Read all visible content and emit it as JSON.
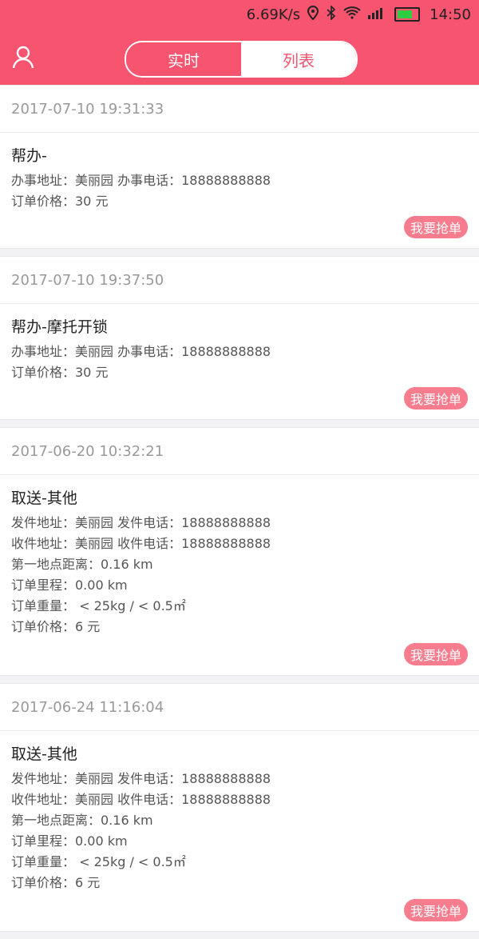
{
  "statusbar": {
    "speed": "6.69K/s",
    "time": "14:50"
  },
  "tabs": [
    {
      "label": "实时"
    },
    {
      "label": "列表"
    }
  ],
  "orders": [
    {
      "time": "2017-07-10 19:31:33",
      "title": "帮办-",
      "rows": [
        "办事地址：美丽园  办事电话：18888888888",
        "订单价格：30 元"
      ],
      "action": "我要抢单"
    },
    {
      "time": "2017-07-10 19:37:50",
      "title": "帮办-摩托开锁",
      "rows": [
        "办事地址：美丽园  办事电话：18888888888",
        "订单价格：30 元"
      ],
      "action": "我要抢单"
    },
    {
      "time": "2017-06-20 10:32:21",
      "title": "取送-其他",
      "rows": [
        "发件地址：美丽园  发件电话：18888888888",
        "收件地址：美丽园  收件电话：18888888888",
        "第一地点距离：0.16 km",
        "订单里程：0.00 km",
        "订单重量： < 25kg / < 0.5㎡",
        "订单价格：6 元"
      ],
      "action": "我要抢单"
    },
    {
      "time": "2017-06-24 11:16:04",
      "title": "取送-其他",
      "rows": [
        "发件地址：美丽园  发件电话：18888888888",
        "收件地址：美丽园  收件电话：18888888888",
        "第一地点距离：0.16 km",
        "订单里程：0.00 km",
        "订单重量： < 25kg / < 0.5㎡",
        "订单价格：6 元"
      ],
      "action": "我要抢单"
    }
  ]
}
